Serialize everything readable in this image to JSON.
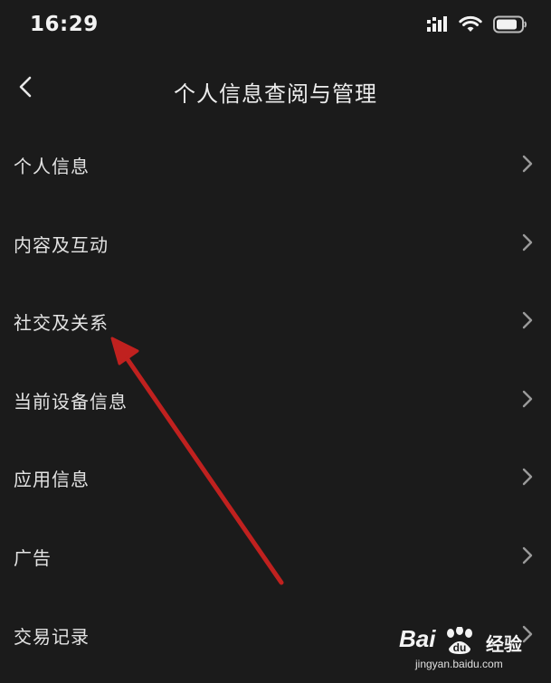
{
  "status_bar": {
    "time": "16:29",
    "icons": [
      "signal-icon",
      "wifi-icon",
      "battery-icon"
    ]
  },
  "header": {
    "title": "个人信息查阅与管理",
    "back_icon": "chevron-left-icon"
  },
  "menu": {
    "items": [
      {
        "label": "个人信息"
      },
      {
        "label": "内容及互动"
      },
      {
        "label": "社交及关系"
      },
      {
        "label": "当前设备信息"
      },
      {
        "label": "应用信息"
      },
      {
        "label": "广告"
      },
      {
        "label": "交易记录"
      }
    ]
  },
  "annotation": {
    "type": "arrow",
    "color": "#c0211f",
    "points_to": "社交及关系"
  },
  "watermark": {
    "brand": "Bai",
    "brand_suffix": "经验",
    "url": "jingyan.baidu.com"
  },
  "colors": {
    "background": "#1b1b1b",
    "text": "#e3e3e3",
    "chevron": "#9a9a9a"
  }
}
